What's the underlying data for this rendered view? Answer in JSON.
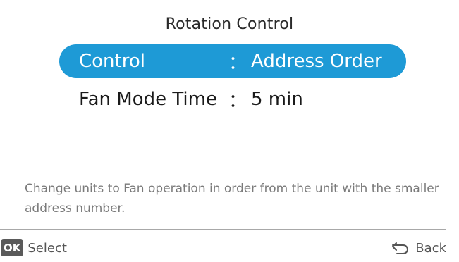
{
  "screen": {
    "title": "Rotation Control",
    "settings": [
      {
        "label": "Control",
        "separator": "：",
        "value": "Address Order",
        "selected": true
      },
      {
        "label": "Fan Mode Time",
        "separator": "：",
        "value": "5 min",
        "selected": false
      }
    ],
    "description": "Change units to Fan operation in order from the unit with the smaller address number."
  },
  "footer": {
    "ok_key": "OK",
    "select_label": "Select",
    "back_label": "Back",
    "back_icon": "return-arrow-icon"
  },
  "colors": {
    "accent": "#1e9ad6",
    "text": "#1a1a1a",
    "description_text": "#7a7a7a",
    "divider": "#a8a8a8",
    "ok_key_bg": "#5a5a5a"
  }
}
